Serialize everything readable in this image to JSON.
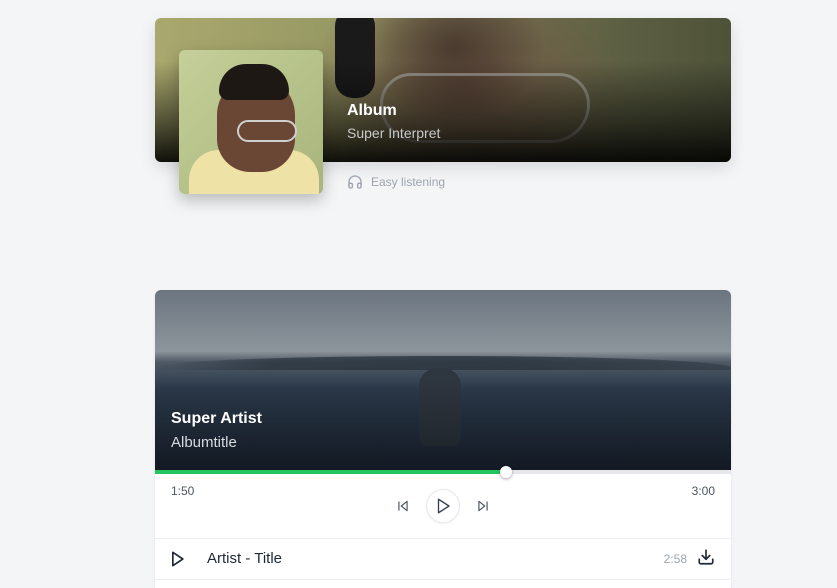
{
  "album": {
    "title": "Album",
    "interpret": "Super Interpret",
    "genre": "Easy listening",
    "genre_icon": "headphones-icon"
  },
  "player": {
    "artist": "Super Artist",
    "album_title": "Albumtitle",
    "current_time": "1:50",
    "total_time": "3:00",
    "progress": 0.61,
    "accent_color": "#22c55e",
    "controls": [
      "skip-back-icon",
      "play-icon",
      "skip-forward-icon"
    ]
  },
  "tracks": [
    {
      "title": "Artist - Title",
      "duration": "2:58",
      "play_icon": "play-icon",
      "action_icon": "download-icon"
    }
  ]
}
